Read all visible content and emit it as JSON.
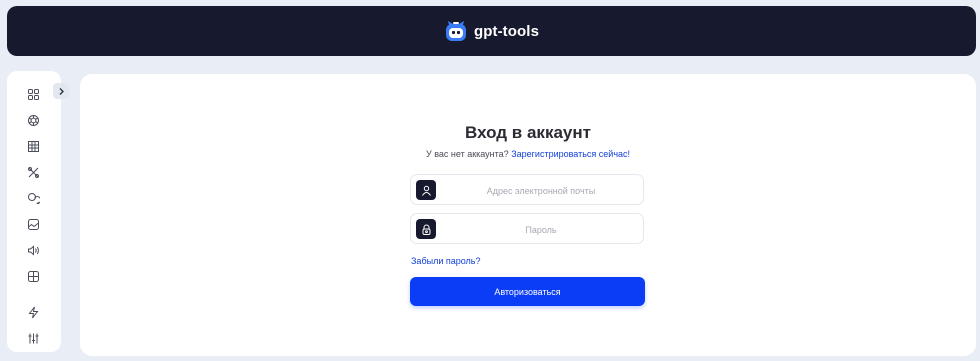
{
  "header": {
    "brand_name": "gpt-tools",
    "logo_icon": "robot-face-icon"
  },
  "sidebar": {
    "toggle_icon": "chevron-right-icon",
    "items": [
      {
        "icon": "grid-icon"
      },
      {
        "icon": "openai-icon"
      },
      {
        "icon": "image-grid-icon"
      },
      {
        "icon": "tools-icon"
      },
      {
        "icon": "chat-icon"
      },
      {
        "icon": "image-icon"
      },
      {
        "icon": "sound-icon"
      },
      {
        "icon": "layout-icon"
      },
      {
        "icon": "lightning-icon"
      },
      {
        "icon": "sliders-icon"
      }
    ]
  },
  "login": {
    "title": "Вход в аккаунт",
    "no_account_text": "У вас нет аккаунта?",
    "register_link": "Зарегистрироваться сейчас!",
    "email_placeholder": "Адрес электронной почты",
    "email_value": "",
    "password_placeholder": "Пароль",
    "password_value": "",
    "forgot_link": "Забыли пароль?",
    "submit_label": "Авторизоваться"
  },
  "colors": {
    "header_bg": "#171a2f",
    "page_bg": "#e9edf5",
    "accent": "#0a3df5",
    "link": "#1440d8",
    "logo_blue": "#3b7cf6"
  }
}
